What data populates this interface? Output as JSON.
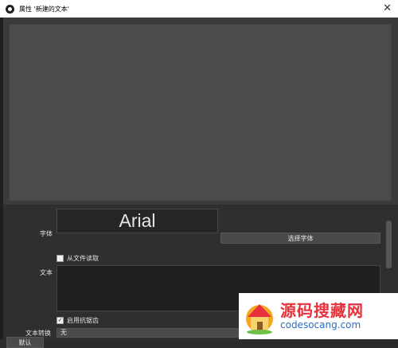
{
  "window": {
    "title": "属性 '新建的文本'"
  },
  "properties": {
    "font_label": "字体",
    "font_preview": "Arial",
    "select_font_button": "选择字体",
    "read_from_file_label": "从文件读取",
    "text_label": "文本",
    "antialias_label": "启用抗锯齿",
    "antialias_checked_glyph": "✓",
    "text_transform_label": "文本转换",
    "text_transform_value": "无"
  },
  "footer": {
    "defaults_button": "默认"
  },
  "watermark": {
    "cn": "源码搜藏网",
    "en": "codesocang.com"
  },
  "icons": {
    "app": "obs-logo-icon",
    "close": "close-icon"
  }
}
